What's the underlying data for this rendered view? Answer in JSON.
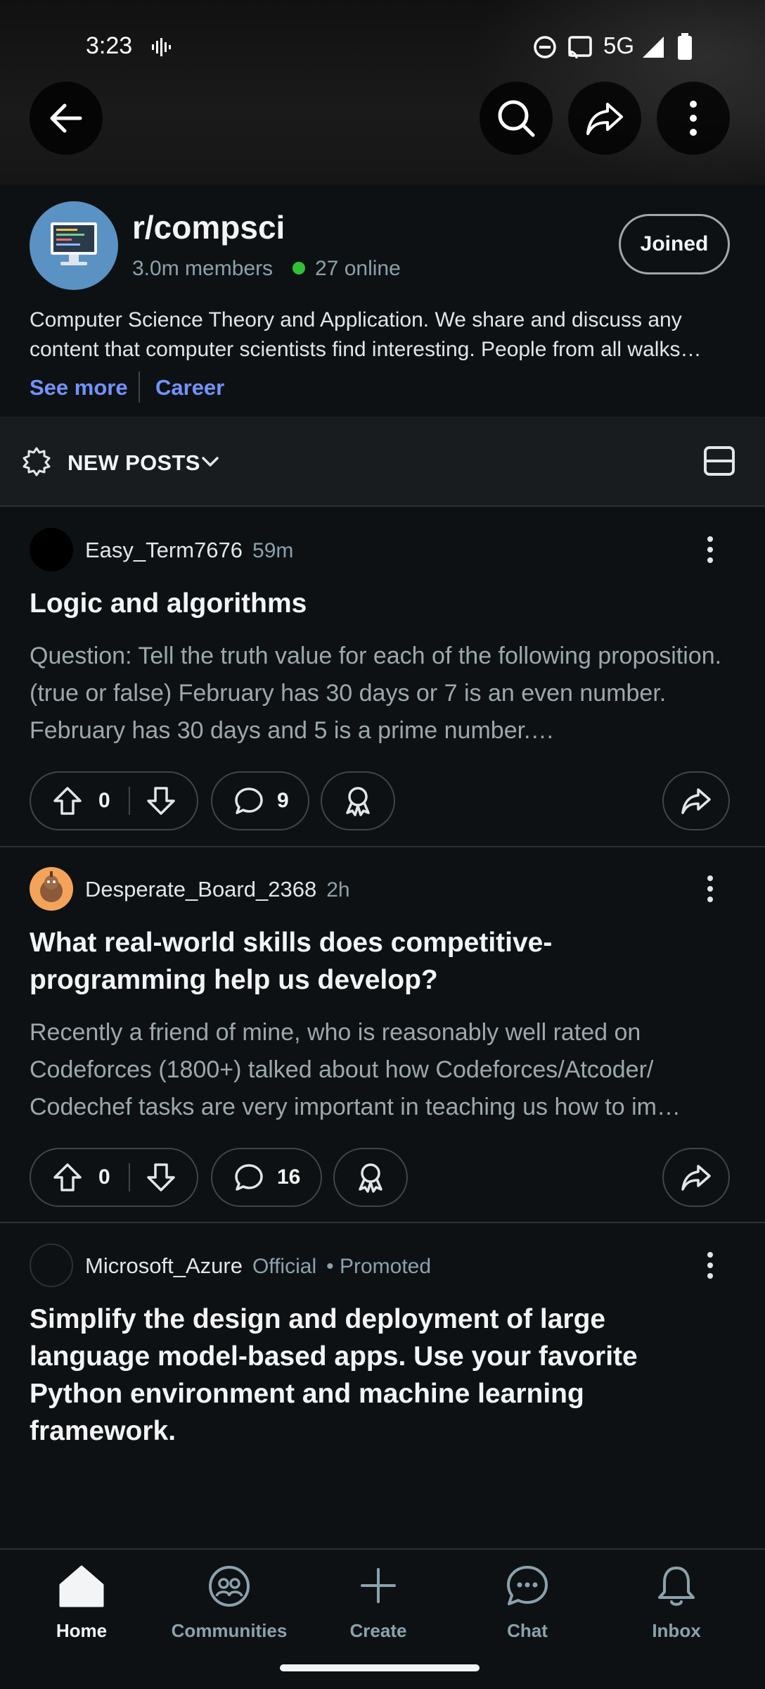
{
  "status_bar": {
    "time": "3:23",
    "network": "5G"
  },
  "community": {
    "name": "r/compsci",
    "members": "3.0m members",
    "online": "27 online",
    "joined_label": "Joined",
    "description": "Computer Science Theory and Application. We share and discuss any content that computer scientists find interesting. People from all walks…",
    "see_more": "See more",
    "career": "Career"
  },
  "sort": {
    "label": "NEW POSTS"
  },
  "posts": [
    {
      "author": "Easy_Term7676",
      "age": "59m",
      "title": "Logic and algorithms",
      "body": "Question: Tell the truth value for each of the following proposition. (true or false) February has 30 days or 7 is an even number. February has 30 days and 5 is a prime number.…",
      "votes": "0",
      "comments": "9"
    },
    {
      "author": "Desperate_Board_2368",
      "age": "2h",
      "title": "What real-world skills does competitive-programming help us develop?",
      "body": "Recently a friend of mine, who is reasonably well rated on Codeforces (1800+) talked about how Codeforces/Atcoder/ Codechef tasks are very important in teaching us how to im…",
      "votes": "0",
      "comments": "16"
    },
    {
      "author": "Microsoft_Azure",
      "official": "Official",
      "promoted": "• Promoted",
      "title": "Simplify the design and deployment of large language model-based apps. Use your favorite Python environment and machine learning framework."
    }
  ],
  "nav": {
    "home": "Home",
    "communities": "Communities",
    "create": "Create",
    "chat": "Chat",
    "inbox": "Inbox"
  },
  "colors": {
    "accent_link": "#7193ff",
    "online": "#2fc234",
    "background": "#0e1113"
  }
}
